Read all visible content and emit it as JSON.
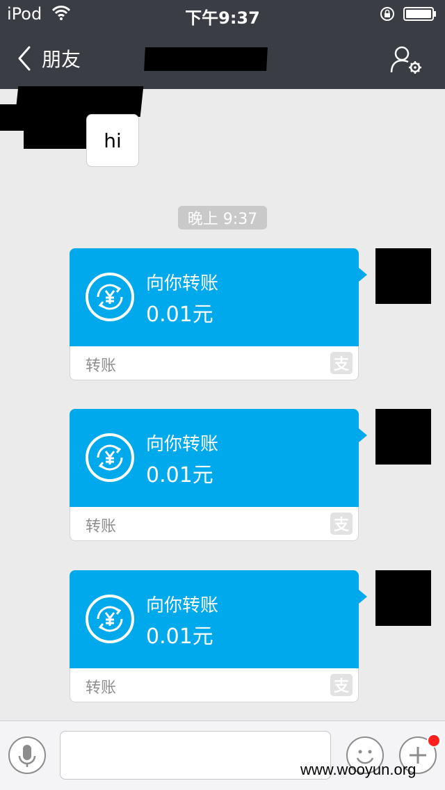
{
  "status_bar": {
    "device": "iPod",
    "time": "下午9:37"
  },
  "nav": {
    "back_label": "朋友"
  },
  "chat": {
    "incoming_text": "hi",
    "timestamp": "晚上 9:37",
    "transfers": [
      {
        "title": "向你转账",
        "amount": "0.01元",
        "label": "转账",
        "badge": "支"
      },
      {
        "title": "向你转账",
        "amount": "0.01元",
        "label": "转账",
        "badge": "支"
      },
      {
        "title": "向你转账",
        "amount": "0.01元",
        "label": "转账",
        "badge": "支"
      }
    ]
  },
  "input_bar": {
    "placeholder": ""
  },
  "watermark": "www.wooyun.org",
  "colors": {
    "nav_bg": "#3a3d44",
    "transfer_blue": "#00a9ec",
    "chat_bg": "#ebebeb",
    "notification": "#ff1f1f"
  }
}
